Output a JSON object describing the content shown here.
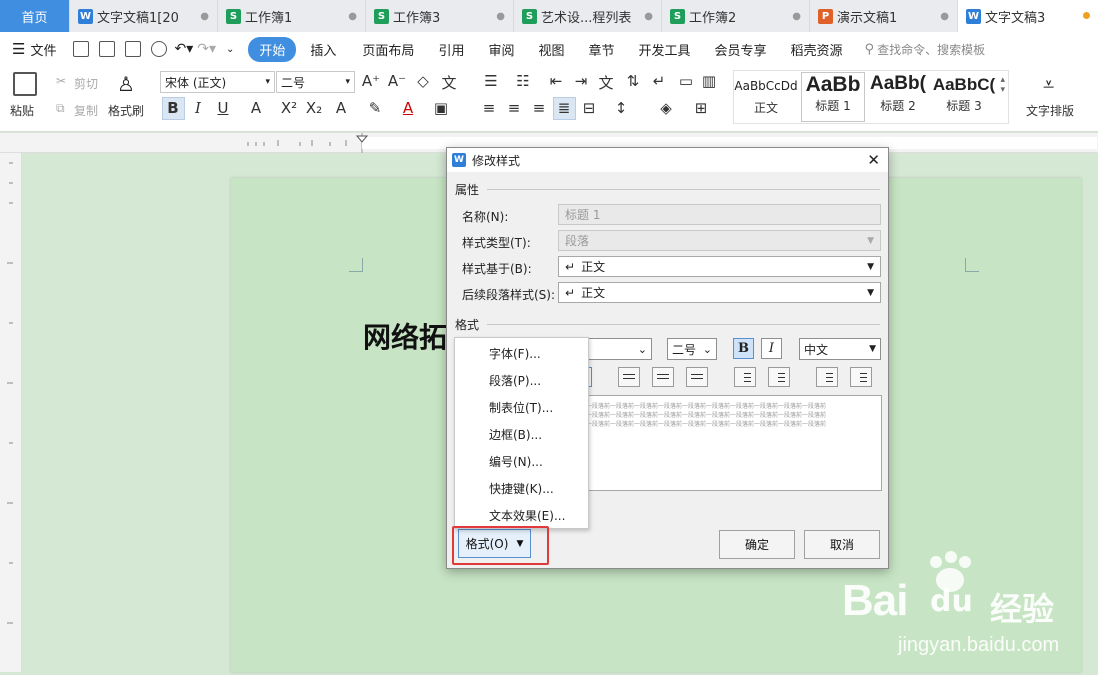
{
  "tabs": [
    {
      "label": "首页",
      "type": "home"
    },
    {
      "label": "文字文稿1[20",
      "icon": "W",
      "icon_color": "#2f7fd8"
    },
    {
      "label": "工作簿1",
      "icon": "S",
      "icon_color": "#1e9e5a"
    },
    {
      "label": "工作簿3",
      "icon": "S",
      "icon_color": "#1e9e5a"
    },
    {
      "label": "艺术设...程列表",
      "icon": "S",
      "icon_color": "#1e9e5a"
    },
    {
      "label": "工作簿2",
      "icon": "S",
      "icon_color": "#1e9e5a"
    },
    {
      "label": "演示文稿1",
      "icon": "P",
      "icon_color": "#e0602a"
    },
    {
      "label": "文字文稿3",
      "icon": "W",
      "icon_color": "#2f7fd8",
      "active": true
    }
  ],
  "menu": {
    "file": "文件",
    "items": [
      "开始",
      "插入",
      "页面布局",
      "引用",
      "审阅",
      "视图",
      "章节",
      "开发工具",
      "会员专享",
      "稻壳资源"
    ],
    "search": "查找命令、搜索模板"
  },
  "ribbon": {
    "paste": "粘贴",
    "cut": "剪切",
    "copy": "复制",
    "format_painter": "格式刷",
    "font_name": "宋体 (正文)",
    "font_size": "二号",
    "styles": [
      {
        "preview": "AaBbCcDd",
        "label": "正文"
      },
      {
        "preview": "AaBb",
        "label": "标题 1"
      },
      {
        "preview": "AaBb(",
        "label": "标题 2"
      },
      {
        "preview": "AaBbC(",
        "label": "标题 3"
      }
    ],
    "text_layout": "文字排版"
  },
  "document": {
    "title_partial": "网络拓"
  },
  "dialog": {
    "title": "修改样式",
    "section_props": "属性",
    "name_label": "名称(N):",
    "name_value": "标题 1",
    "type_label": "样式类型(T):",
    "type_value": "段落",
    "based_label": "样式基于(B):",
    "based_value": "正文",
    "next_label": "后续段落样式(S):",
    "next_value": "正文",
    "section_format": "格式",
    "size_value": "二号",
    "bold": "B",
    "italic": "I",
    "lang_value": "中文",
    "preview_text": "一段落前一段落前一段落前一段落前一段落前一段落前一段落前一段落前一段落前一段落前",
    "preview_cursor": "",
    "format_button": "格式(O)",
    "ok": "确定",
    "cancel": "取消"
  },
  "format_menu": [
    "字体(F)...",
    "段落(P)...",
    "制表位(T)...",
    "边框(B)...",
    "编号(N)...",
    "快捷键(K)...",
    "文本效果(E)..."
  ],
  "watermark": {
    "brand": "Bai",
    "brand_cn": "经验",
    "url": "jingyan.baidu.com"
  }
}
